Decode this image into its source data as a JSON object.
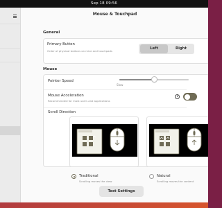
{
  "topbar": {
    "clock": "Sep 18  09:56"
  },
  "window": {
    "title": "Mouse & Touchpad"
  },
  "general": {
    "heading": "General",
    "primary_button": {
      "title": "Primary Button",
      "subtitle": "Order of physical buttons on mice and touchpads",
      "options": [
        "Left",
        "Right"
      ],
      "selected": "Left"
    }
  },
  "mouse": {
    "heading": "Mouse",
    "pointer_speed": {
      "title": "Pointer Speed",
      "min_label": "Slow",
      "value": 0.5
    },
    "acceleration": {
      "title": "Mouse Acceleration",
      "subtitle": "Recommended for most users and applications",
      "enabled": true,
      "info_icon": "info-icon"
    },
    "scroll_direction": {
      "title": "Scroll Direction",
      "options": [
        {
          "title": "Traditional",
          "subtitle": "Scrolling moves the view",
          "selected": true
        },
        {
          "title": "Natural",
          "subtitle": "Scrolling moves the content",
          "selected": false
        }
      ]
    }
  },
  "footer": {
    "test_button": "Test Settings"
  },
  "colors": {
    "accent": "#6f6b55",
    "wallpaper": "#9a2c4a",
    "topbar": "#121212"
  }
}
